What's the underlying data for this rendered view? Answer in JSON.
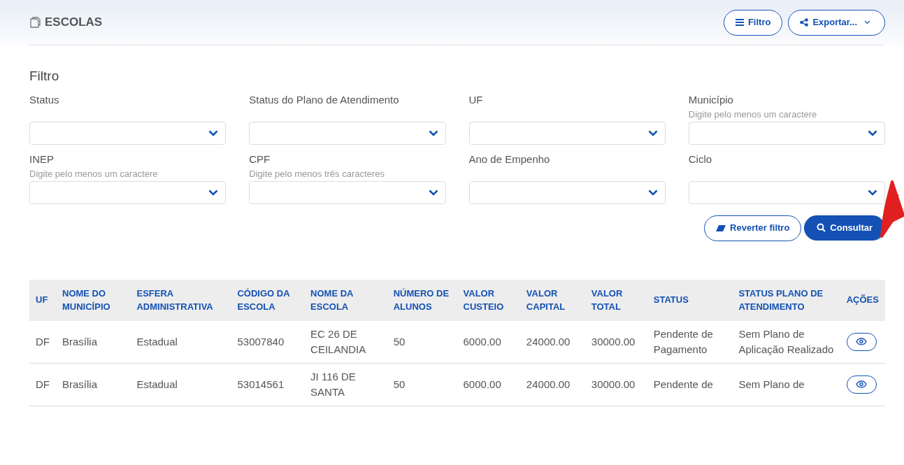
{
  "header": {
    "title": "ESCOLAS",
    "buttons": [
      {
        "kind": "filter",
        "label": "Filtro"
      },
      {
        "kind": "export",
        "label": "Exportar..."
      }
    ]
  },
  "filter": {
    "title": "Filtro",
    "fields": [
      {
        "label": "Status"
      },
      {
        "label": "Status do Plano de Atendimento"
      },
      {
        "label": "UF"
      },
      {
        "label": "Município",
        "hint": "Digite pelo menos um caractere"
      },
      {
        "label": "INEP",
        "hint": "Digite pelo menos um caractere"
      },
      {
        "label": "CPF",
        "hint": "Digite pelo menos três caracteres"
      },
      {
        "label": "Ano de Empenho"
      },
      {
        "label": "Ciclo"
      }
    ],
    "actions": [
      {
        "kind": "reset",
        "label": "Reverter filtro"
      },
      {
        "kind": "search",
        "label": "Consultar"
      }
    ]
  },
  "table": {
    "columns": [
      "UF",
      "NOME DO MUNICÍPIO",
      "ESFERA ADMINISTRATIVA",
      "CÓDIGO DA ESCOLA",
      "NOME DA ESCOLA",
      "NÚMERO DE ALUNOS",
      "VALOR CUSTEIO",
      "VALOR CAPITAL",
      "VALOR TOTAL",
      "STATUS",
      "STATUS PLANO DE ATENDIMENTO",
      "AÇÕES"
    ],
    "rows": [
      {
        "cells": [
          "DF",
          "Brasília",
          "Estadual",
          "53007840",
          "EC 26 DE CEILANDIA",
          "50",
          "6000.00",
          "24000.00",
          "30000.00",
          "Pendente de Pagamento",
          "Sem Plano de Aplicação Realizado"
        ]
      },
      {
        "cells": [
          "DF",
          "Brasília",
          "Estadual",
          "53014561",
          "JI 116 DE SANTA",
          "50",
          "6000.00",
          "24000.00",
          "30000.00",
          "Pendente de",
          "Sem Plano de"
        ]
      }
    ]
  }
}
